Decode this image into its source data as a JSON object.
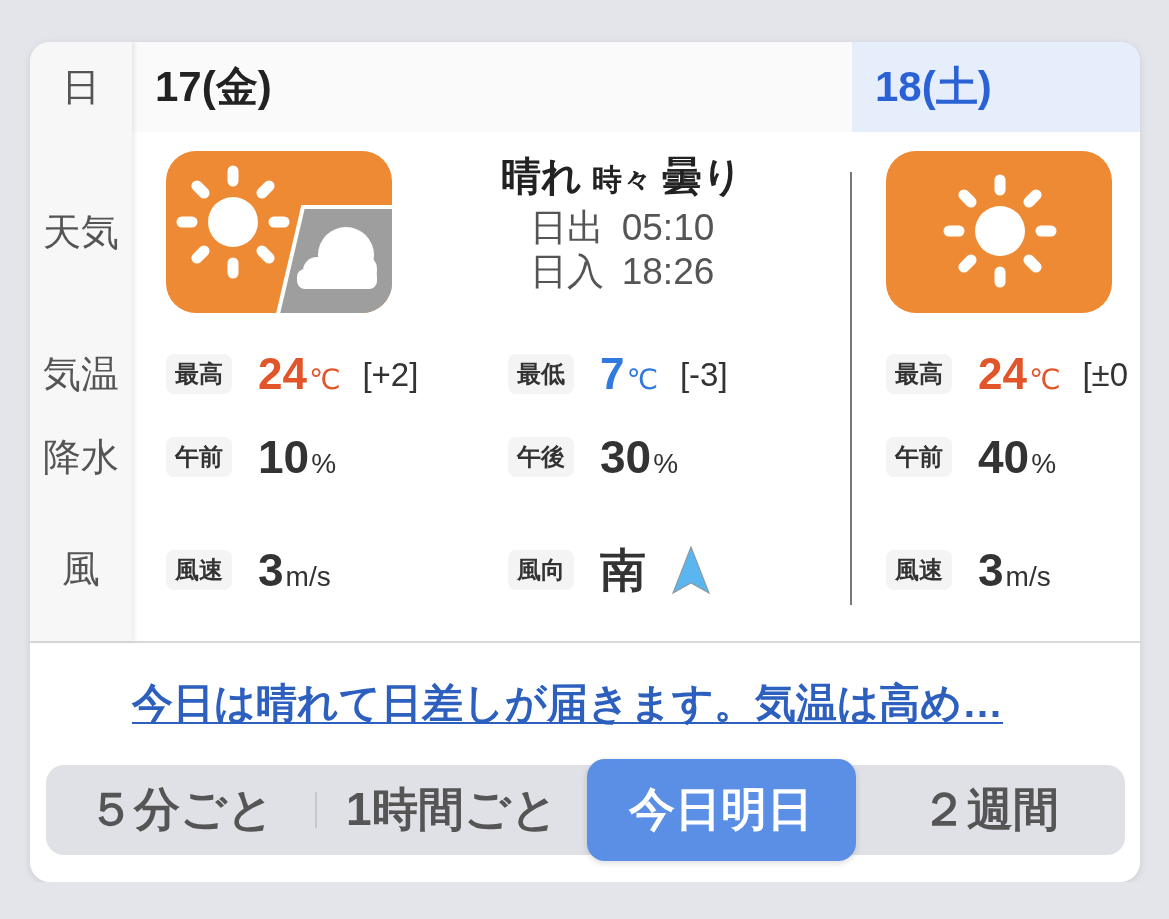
{
  "row_labels": [
    "日",
    "天気",
    "気温",
    "降水",
    "風"
  ],
  "days": [
    {
      "date": "17(金)",
      "kind": "weekday",
      "weather": {
        "kind": "sunny_then_cloudy",
        "summary": [
          {
            "text": "晴れ",
            "kind": "main"
          },
          {
            "text": "時々",
            "kind": "joiner"
          },
          {
            "text": "曇り",
            "kind": "main"
          }
        ],
        "sun_times": [
          {
            "label": "日出",
            "time": "05:10"
          },
          {
            "label": "日入",
            "time": "18:26"
          }
        ]
      },
      "temperature": [
        {
          "label": "最高",
          "value": "24",
          "unit": "℃",
          "kind": "high",
          "diff": "[+2]"
        },
        {
          "label": "最低",
          "value": "7",
          "unit": "℃",
          "kind": "low",
          "diff": "[-3]"
        }
      ],
      "precipitation": [
        {
          "label": "午前",
          "value": "10",
          "unit": "%"
        },
        {
          "label": "午後",
          "value": "30",
          "unit": "%"
        }
      ],
      "wind": [
        {
          "label": "風速",
          "value": "3",
          "unit": "m/s",
          "kind": "speed"
        },
        {
          "label": "風向",
          "value": "南",
          "kind": "direction"
        }
      ]
    },
    {
      "date": "18(土)",
      "kind": "saturday",
      "weather": {
        "kind": "sunny"
      },
      "temperature": [
        {
          "label": "最高",
          "value": "24",
          "unit": "℃",
          "kind": "high",
          "diff": "[±0"
        }
      ],
      "precipitation": [
        {
          "label": "午前",
          "value": "40",
          "unit": "%"
        }
      ],
      "wind": [
        {
          "label": "風速",
          "value": "3",
          "unit": "m/s",
          "kind": "speed"
        }
      ]
    }
  ],
  "summary_link": "今日は晴れて日差しが届きます。気温は高め…",
  "tabs": [
    {
      "label": "５分ごと",
      "selected": false
    },
    {
      "label": "1時間ごと",
      "selected": false
    },
    {
      "label": "今日明日",
      "selected": true
    },
    {
      "label": "２週間",
      "selected": false
    }
  ]
}
